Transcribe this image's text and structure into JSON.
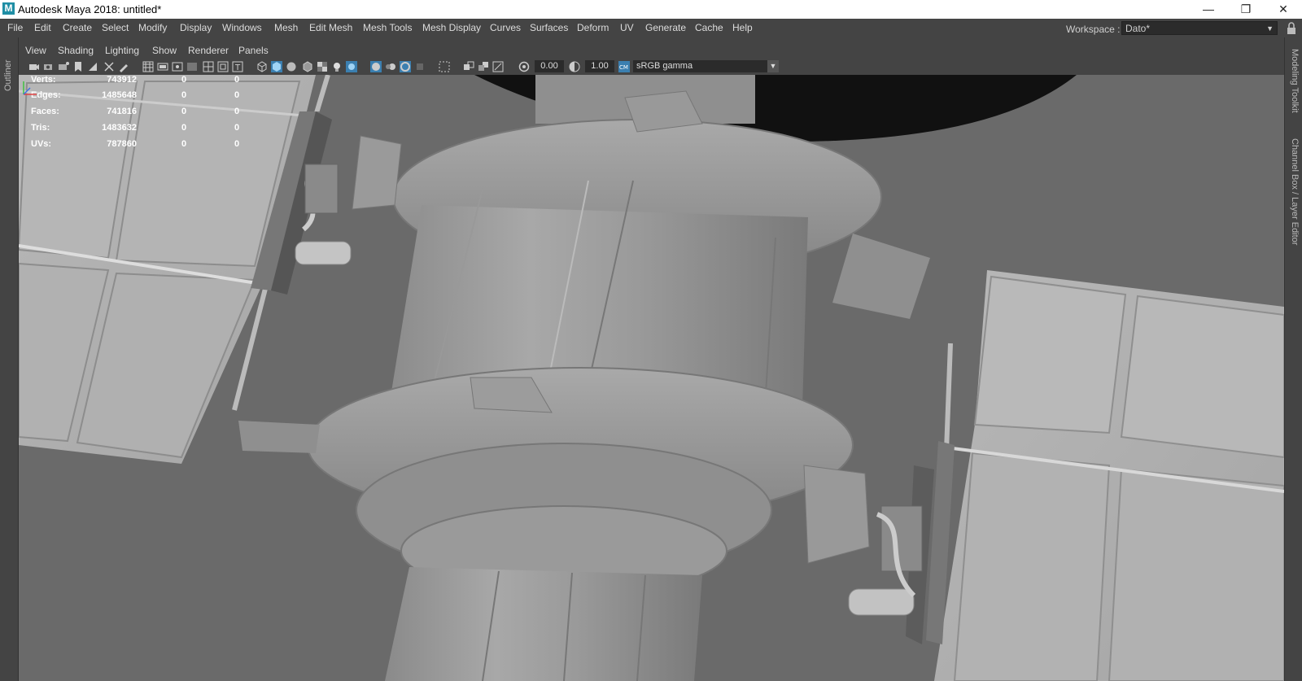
{
  "window": {
    "title": "Autodesk Maya 2018: untitled*",
    "logo_letter": "M",
    "minimize": "—",
    "restore": "❐",
    "close": "✕"
  },
  "menubar": {
    "items": [
      "File",
      "Edit",
      "Create",
      "Select",
      "Modify",
      "Display",
      "Windows",
      "Mesh",
      "Edit Mesh",
      "Mesh Tools",
      "Mesh Display",
      "Curves",
      "Surfaces",
      "Deform",
      "UV",
      "Generate",
      "Cache",
      "Help"
    ],
    "workspace_label": "Workspace :",
    "workspace_value": "Dato*"
  },
  "side_panels": {
    "left": "Outliner",
    "right_top": "Modeling Toolkit",
    "right_bottom": "Channel Box / Layer Editor"
  },
  "viewport_menu": {
    "items": [
      "View",
      "Shading",
      "Lighting",
      "Show",
      "Renderer",
      "Panels"
    ]
  },
  "viewport_toolbar": {
    "exposure": "0.00",
    "gamma": "1.00",
    "color_space": "sRGB gamma"
  },
  "hud": {
    "rows": [
      {
        "label": "Verts:",
        "v1": "743912",
        "v2": "0",
        "v3": "0"
      },
      {
        "label": "Edges:",
        "v1": "1485648",
        "v2": "0",
        "v3": "0"
      },
      {
        "label": "Faces:",
        "v1": "741816",
        "v2": "0",
        "v3": "0"
      },
      {
        "label": "Tris:",
        "v1": "1483632",
        "v2": "0",
        "v3": "0"
      },
      {
        "label": "UVs:",
        "v1": "787860",
        "v2": "0",
        "v3": "0"
      }
    ]
  },
  "colors": {
    "viewport_bg": "#6a6a6a",
    "ui_bg": "#444444",
    "accent_blue": "#4aa3df"
  }
}
